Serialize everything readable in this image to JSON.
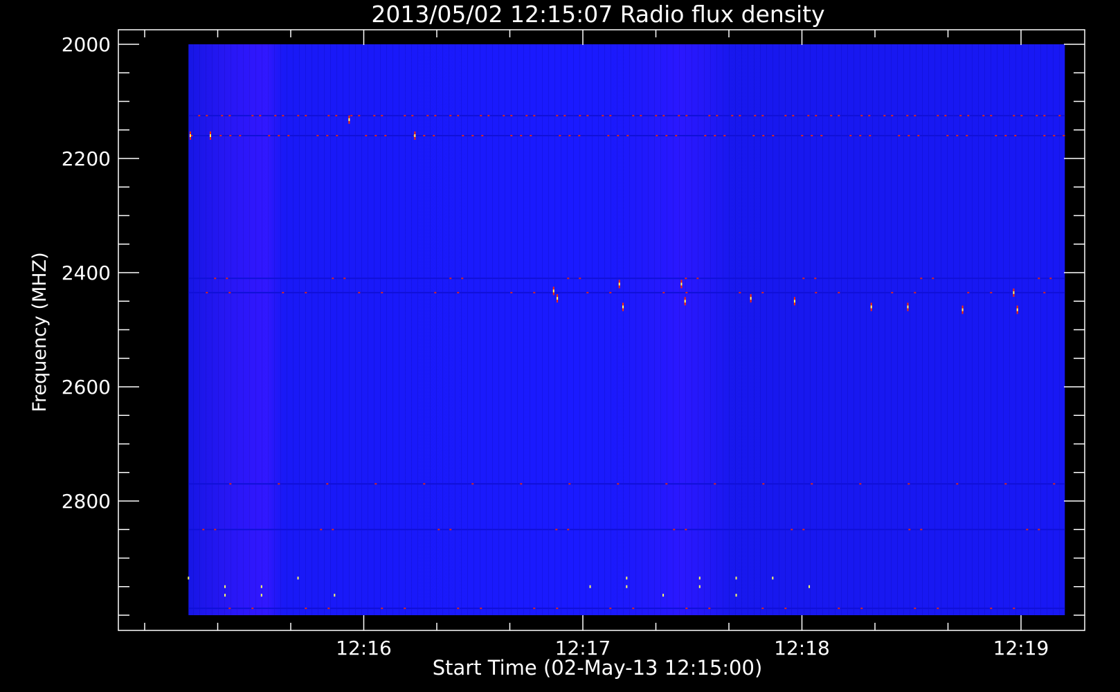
{
  "chart_data": {
    "type": "heatmap",
    "title": "2013/05/02 12:15:07 Radio flux density",
    "xlabel": "Start Time (02-May-13 12:15:00)",
    "ylabel": "Frequency (MHZ)",
    "x_tick_labels": [
      "12:16",
      "12:17",
      "12:18",
      "12:19"
    ],
    "x_ticks_seconds": [
      60,
      120,
      180,
      240
    ],
    "y_tick_labels": [
      "2000",
      "2200",
      "2400",
      "2600",
      "2800"
    ],
    "y_ticks": [
      2000,
      2200,
      2400,
      2600,
      2800
    ],
    "ylim": [
      2000,
      3000
    ],
    "xlim_seconds": [
      0,
      240
    ],
    "data_x_range_seconds": [
      12,
      252
    ],
    "y_axis_inverted": true,
    "colors": {
      "background": "#000000",
      "axes": "#ffffff",
      "field": "#1a1aff",
      "field_dark": "#1010d8",
      "burst_hot": "#ff2a00",
      "burst_bright": "#ffff66"
    },
    "horizontal_bands_mhz": [
      2125,
      2160,
      2410,
      2435,
      2770,
      2850,
      2988
    ],
    "bright_band_mhz": [
      2125,
      2160
    ],
    "burst_events": [
      {
        "t": 12.5,
        "f": 2160
      },
      {
        "t": 18,
        "f": 2160
      },
      {
        "t": 56,
        "f": 2132
      },
      {
        "t": 74,
        "f": 2160
      },
      {
        "t": 112,
        "f": 2432
      },
      {
        "t": 113,
        "f": 2445
      },
      {
        "t": 130,
        "f": 2420
      },
      {
        "t": 131,
        "f": 2460
      },
      {
        "t": 147,
        "f": 2420
      },
      {
        "t": 148,
        "f": 2450
      },
      {
        "t": 166,
        "f": 2445
      },
      {
        "t": 178,
        "f": 2450
      },
      {
        "t": 199,
        "f": 2460
      },
      {
        "t": 209,
        "f": 2460
      },
      {
        "t": 224,
        "f": 2465
      },
      {
        "t": 238,
        "f": 2435
      },
      {
        "t": 239,
        "f": 2465
      }
    ],
    "low_band_dots": [
      {
        "t": 12,
        "f": 2935
      },
      {
        "t": 22,
        "f": 2950
      },
      {
        "t": 22,
        "f": 2965
      },
      {
        "t": 32,
        "f": 2950
      },
      {
        "t": 32,
        "f": 2965
      },
      {
        "t": 42,
        "f": 2935
      },
      {
        "t": 52,
        "f": 2965
      },
      {
        "t": 122,
        "f": 2950
      },
      {
        "t": 132,
        "f": 2935
      },
      {
        "t": 132,
        "f": 2950
      },
      {
        "t": 142,
        "f": 2965
      },
      {
        "t": 152,
        "f": 2935
      },
      {
        "t": 152,
        "f": 2950
      },
      {
        "t": 162,
        "f": 2935
      },
      {
        "t": 162,
        "f": 2965
      },
      {
        "t": 172,
        "f": 2935
      },
      {
        "t": 182,
        "f": 2950
      }
    ]
  }
}
